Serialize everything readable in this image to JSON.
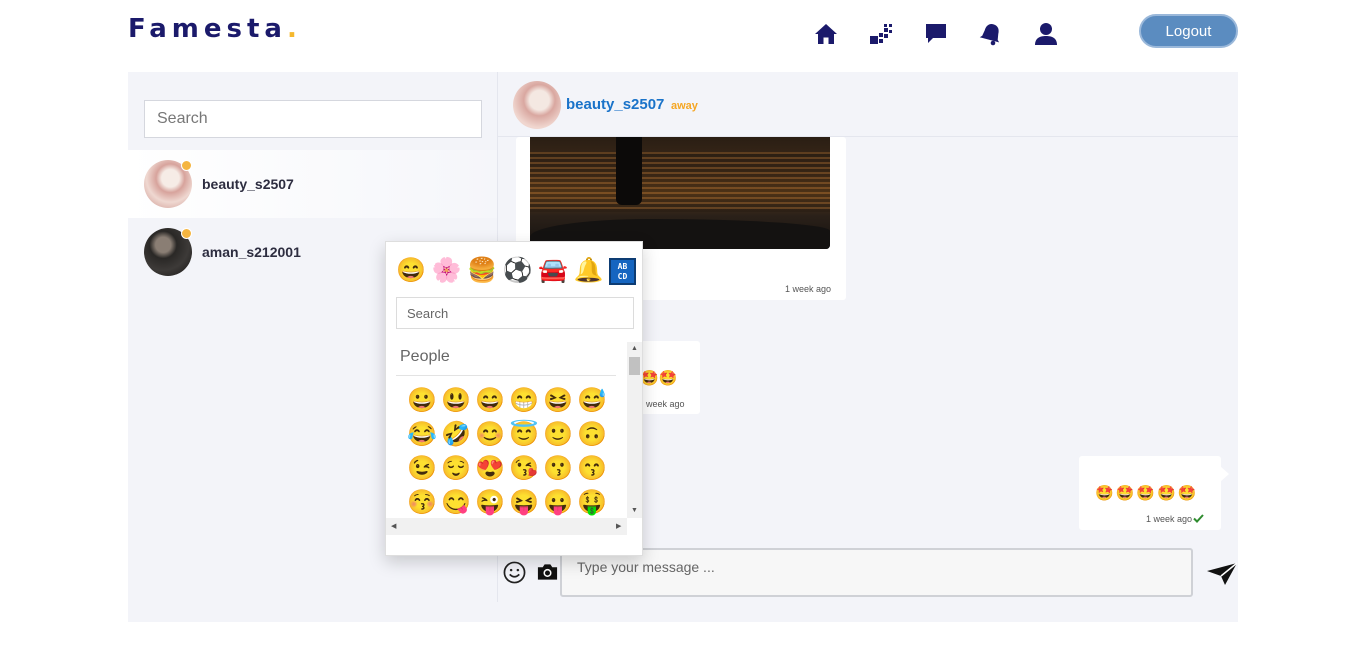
{
  "brand": {
    "name": "Famesta",
    "dot": "."
  },
  "nav": [
    {
      "name": "home-icon"
    },
    {
      "name": "explore-icon"
    },
    {
      "name": "chat-icon"
    },
    {
      "name": "notifications-icon"
    },
    {
      "name": "profile-icon"
    }
  ],
  "header": {
    "logout_label": "Logout"
  },
  "sidebar": {
    "search_placeholder": "Search",
    "contacts": [
      {
        "name": "beauty_s2507",
        "active": true
      },
      {
        "name": "aman_s212001",
        "active": false
      }
    ]
  },
  "chat": {
    "name": "beauty_s2507",
    "status": "away",
    "messages": [
      {
        "type": "image",
        "time": "1 week ago"
      },
      {
        "type": "emoji",
        "text": "🤩🤩",
        "time": "1 week ago"
      },
      {
        "type": "emoji",
        "text": "🤩🤩🤩🤩🤩",
        "time": "1 week ago",
        "own": true,
        "read": true
      }
    ],
    "input_placeholder": "Type your message ..."
  },
  "emoji_picker": {
    "categories": [
      "😄",
      "🌸",
      "🍔",
      "⚽",
      "🚘",
      "🔔",
      "AB CD"
    ],
    "search_placeholder": "Search",
    "section_title": "People",
    "emojis": [
      "😀",
      "😃",
      "😄",
      "😁",
      "😆",
      "😅",
      "😂",
      "🤣",
      "😊",
      "😇",
      "🙂",
      "🙃",
      "😉",
      "😌",
      "😍",
      "😘",
      "😗",
      "😙",
      "😚",
      "😋",
      "😜",
      "😝",
      "😛",
      "🤑"
    ]
  },
  "colors": {
    "brand": "#1b1a6b",
    "accent": "#f5b82e",
    "logout": "#5b8cc0",
    "link": "#1a73c9",
    "away": "#f5a623"
  }
}
